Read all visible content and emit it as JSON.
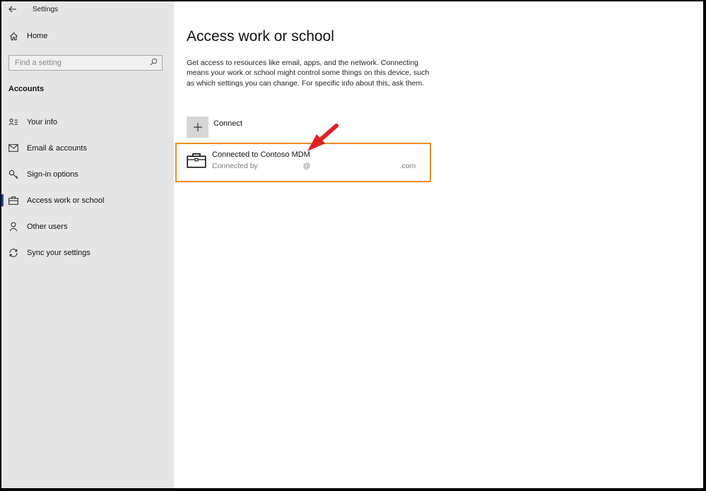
{
  "window": {
    "title": "Settings"
  },
  "sidebar": {
    "home_label": "Home",
    "search_placeholder": "Find a setting",
    "section_label": "Accounts",
    "items": [
      {
        "label": "Your info",
        "icon": "contact-card-icon"
      },
      {
        "label": "Email & accounts",
        "icon": "mail-icon"
      },
      {
        "label": "Sign-in options",
        "icon": "key-icon"
      },
      {
        "label": "Access work or school",
        "icon": "briefcase-icon",
        "selected": true
      },
      {
        "label": "Other users",
        "icon": "person-icon"
      },
      {
        "label": "Sync your settings",
        "icon": "sync-icon"
      }
    ]
  },
  "main": {
    "title": "Access work or school",
    "description": "Get access to resources like email, apps, and the network. Connecting means your work or school might control some things on this device, such as which settings you can change. For specific info about this, ask them.",
    "connect_label": "Connect",
    "account": {
      "title": "Connected to Contoso MDM",
      "subtitle_prefix": "Connected by",
      "subtitle_at": "@",
      "subtitle_suffix": ".com"
    }
  },
  "colors": {
    "sidebar_bg": "#e6e6e6",
    "highlight_border": "#f08a24",
    "annotation_arrow": "#e02020",
    "selection_accent": "#1f4e9c"
  }
}
